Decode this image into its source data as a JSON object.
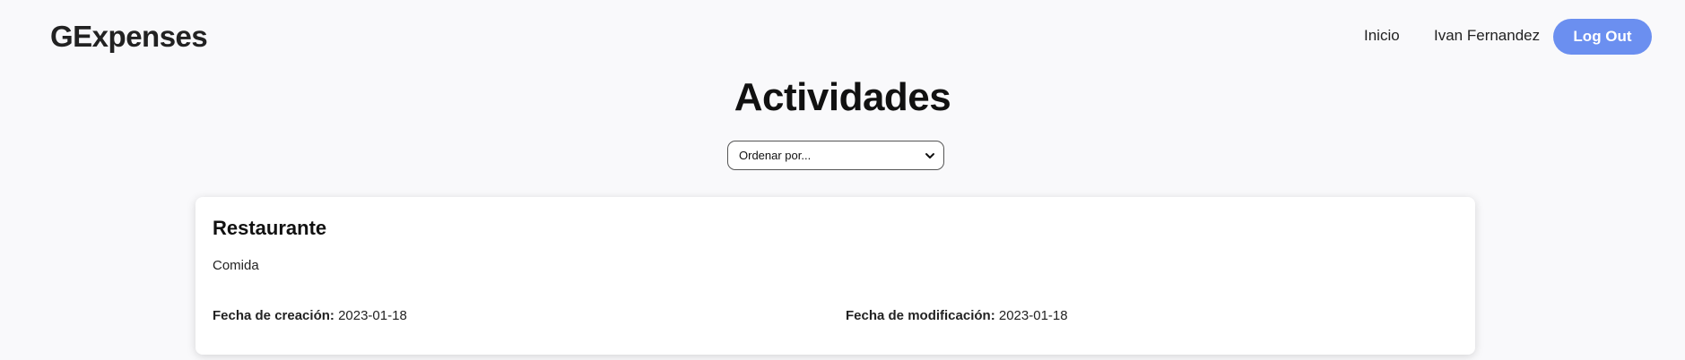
{
  "navbar": {
    "brand": "GExpenses",
    "links": {
      "home": "Inicio",
      "user": "Ivan Fernandez"
    },
    "logout_label": "Log Out",
    "accent_color": "#6b8ff0"
  },
  "main": {
    "title": "Actividades",
    "sort": {
      "selected": "Ordenar por...",
      "icon": "chevron-down-icon"
    },
    "activities": [
      {
        "name": "Restaurante",
        "category": "Comida",
        "created_label": "Fecha de creación:",
        "created_value": "2023-01-18",
        "modified_label": "Fecha de modificación:",
        "modified_value": "2023-01-18"
      }
    ]
  }
}
